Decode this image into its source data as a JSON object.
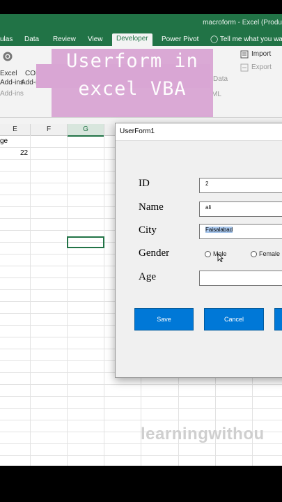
{
  "window": {
    "title": "macroform - Excel (Produ"
  },
  "ribbon_tabs": [
    {
      "label": "ulas"
    },
    {
      "label": "Data"
    },
    {
      "label": "Review"
    },
    {
      "label": "View"
    },
    {
      "label": "Developer"
    },
    {
      "label": "Power Pivot"
    },
    {
      "label": "Tell me what you wa"
    }
  ],
  "ribbon": {
    "excel_addins": [
      "Excel",
      "Add-ins"
    ],
    "com_addins": [
      "COM",
      "Add-ins"
    ],
    "group_label": "Add-ins",
    "data_label": "Data",
    "xml_label": "ML",
    "import_label": "Import",
    "export_label": "Export"
  },
  "banner": {
    "line1": "Userform in",
    "line2": "excel VBA"
  },
  "grid": {
    "columns": [
      "E",
      "F",
      "G"
    ],
    "selected_column": "G",
    "cells": {
      "e1": "ge",
      "e2": "22"
    }
  },
  "userform": {
    "title": "UserForm1",
    "labels": {
      "id": "ID",
      "name": "Name",
      "city": "City",
      "gender": "Gender",
      "age": "Age"
    },
    "values": {
      "id": "2",
      "name": "ali",
      "city": "Faisalabad",
      "age": ""
    },
    "gender_options": [
      "Male",
      "Female"
    ],
    "buttons": {
      "save": "Save",
      "cancel": "Cancel"
    }
  },
  "watermark": "learningwithou",
  "colors": {
    "excel_green": "#217346",
    "banner": "#d9a6d4",
    "button_blue": "#0078d7"
  }
}
